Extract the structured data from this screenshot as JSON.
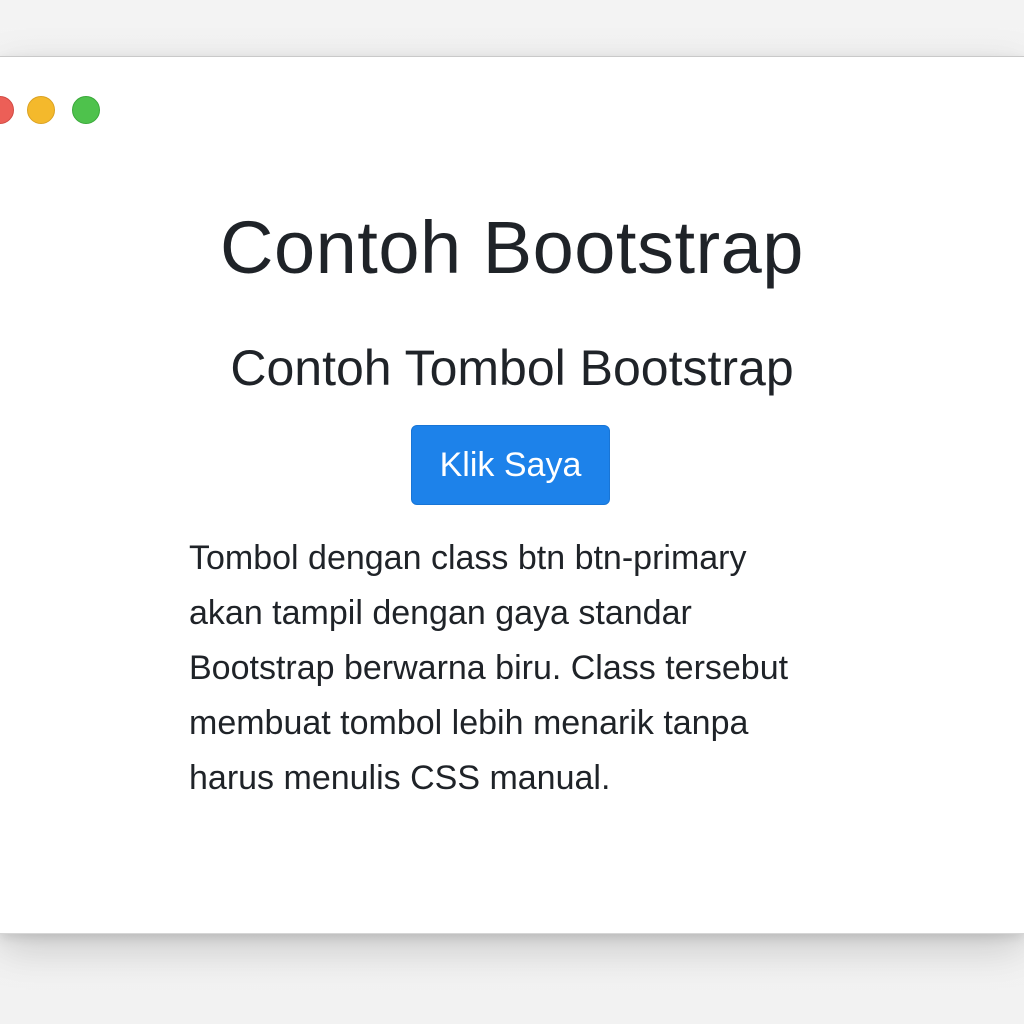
{
  "window": {
    "controls": {
      "close_color": "#ec5f57",
      "minimize_color": "#f4b92c",
      "maximize_color": "#4ec24c"
    }
  },
  "page": {
    "title": "Contoh Bootstrap",
    "subtitle": "Contoh Tombol Bootstrap",
    "button_label": "Klik Saya",
    "description_lines": [
      "Tombol dengan class btn btn-primary",
      "akan tampil dengan gaya standar",
      "Bootstrap berwarna biru. Class tersebut",
      "membuat tombol lebih menarik tanpa",
      "harus menulis CSS manual."
    ]
  },
  "colors": {
    "primary": "#1d82ea",
    "text": "#1f2328"
  }
}
